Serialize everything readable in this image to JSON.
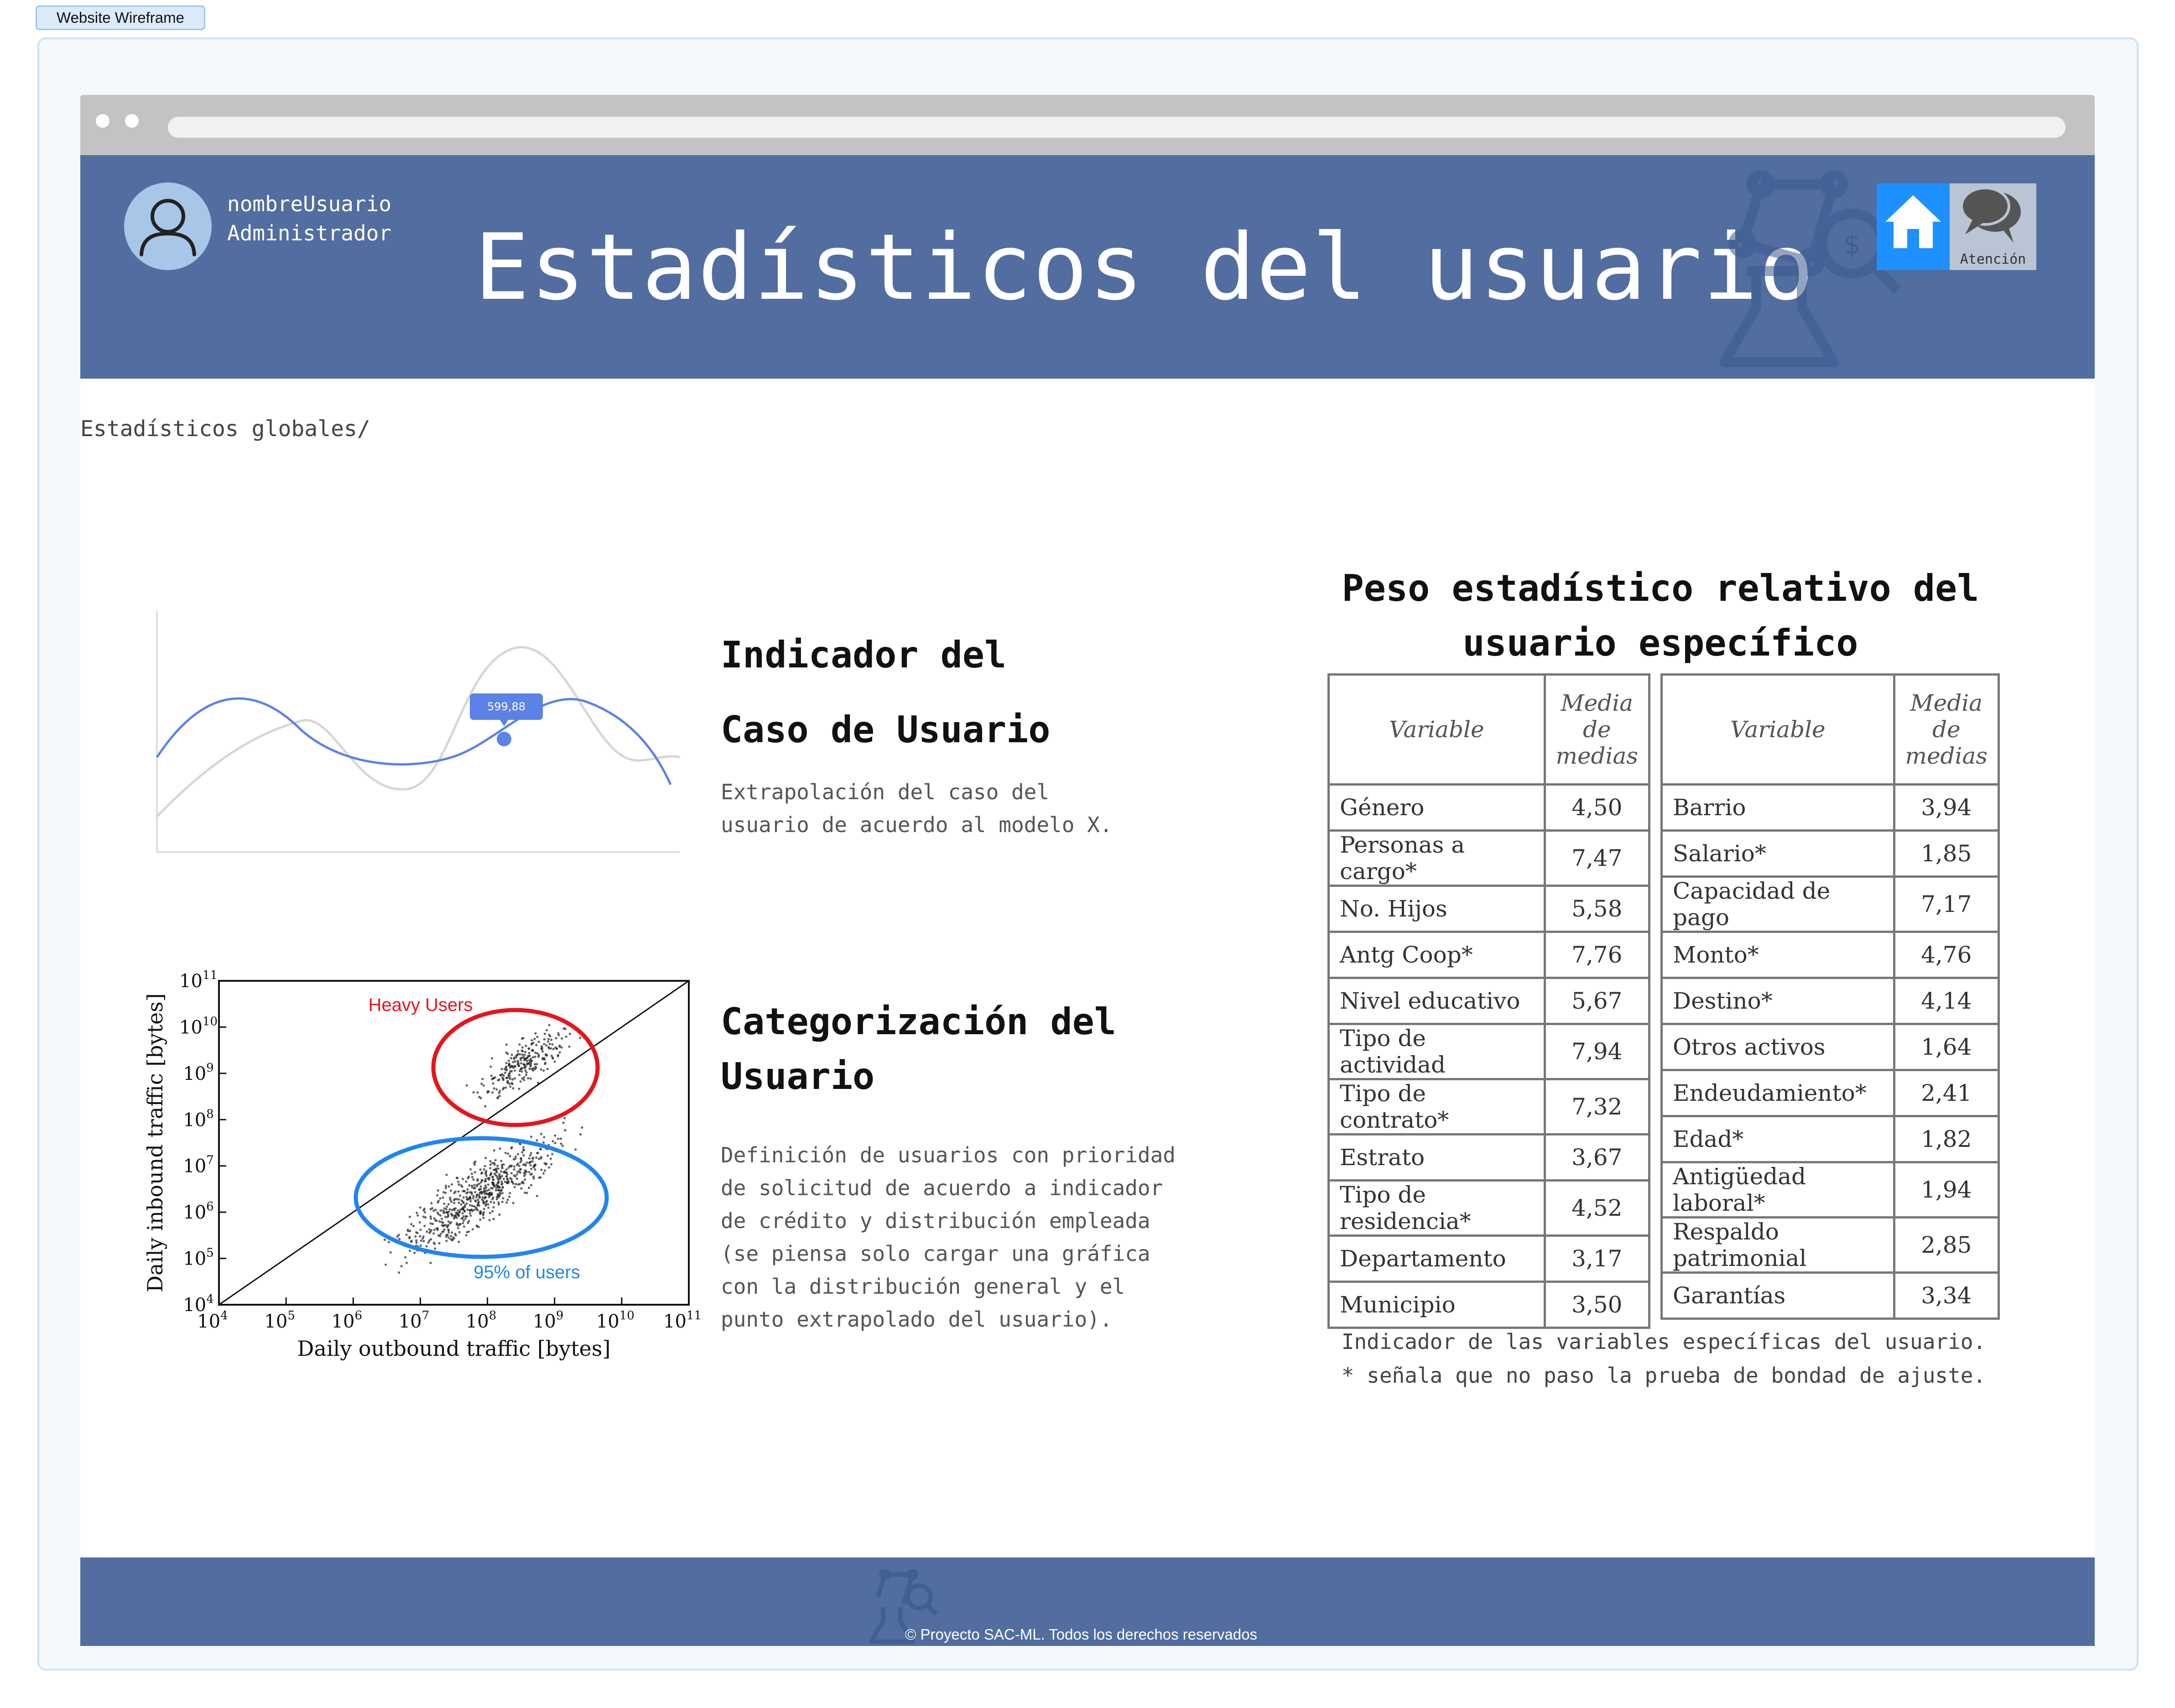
{
  "frame": {
    "label": "Website Wireframe"
  },
  "user": {
    "name": "nombreUsuario",
    "role": "Administrador"
  },
  "header": {
    "title": "Estadísticos del usuario",
    "attention_label": "Atención"
  },
  "breadcrumb": "Estadísticos globales/",
  "indicator": {
    "title_line1": "Indicador del",
    "title_line2": "Caso de Usuario",
    "description": "Extrapolación del caso del\nusuario de acuerdo al modelo X.",
    "tooltip_value": "599,88"
  },
  "categorization": {
    "title_line1": "Categorización del",
    "title_line2": "Usuario",
    "description": "Definición de usuarios con prioridad\nde solicitud de acuerdo a indicador\nde crédito y distribución empleada\n(se piensa solo cargar una gráfica\ncon la distribución general y el\npunto extrapolado del usuario)."
  },
  "scatter": {
    "heavy_label": "Heavy Users",
    "users_label": "95% of users",
    "xlabel": "Daily outbound traffic [bytes]",
    "ylabel": "Daily inbound traffic [bytes]",
    "tick_base": "10",
    "x_exponents": [
      "4",
      "5",
      "6",
      "7",
      "8",
      "9",
      "10",
      "11"
    ],
    "y_exponents": [
      "4",
      "5",
      "6",
      "7",
      "8",
      "9",
      "10",
      "11"
    ]
  },
  "stats": {
    "title_line1": "Peso estadístico relativo del",
    "title_line2": "usuario específico",
    "headers": {
      "variable": "Variable",
      "media_left": "Media de medias",
      "media_right": "Media de medias"
    },
    "left_rows": [
      {
        "variable": "Género",
        "value": "4,50"
      },
      {
        "variable": "Personas a cargo*",
        "value": "7,47"
      },
      {
        "variable": "No. Hijos",
        "value": "5,58"
      },
      {
        "variable": "Antg Coop*",
        "value": "7,76"
      },
      {
        "variable": "Nivel educativo",
        "value": "5,67"
      },
      {
        "variable": "Tipo de actividad",
        "value": "7,94"
      },
      {
        "variable": "Tipo de contrato*",
        "value": "7,32"
      },
      {
        "variable": "Estrato",
        "value": "3,67"
      },
      {
        "variable": "Tipo de residencia*",
        "value": "4,52"
      },
      {
        "variable": "Departamento",
        "value": "3,17"
      },
      {
        "variable": "Municipio",
        "value": "3,50"
      }
    ],
    "right_rows": [
      {
        "variable": "Barrio",
        "value": "3,94"
      },
      {
        "variable": "Salario*",
        "value": "1,85"
      },
      {
        "variable": "Capacidad de pago",
        "value": "7,17"
      },
      {
        "variable": "Monto*",
        "value": "4,76"
      },
      {
        "variable": "Destino*",
        "value": "4,14"
      },
      {
        "variable": "Otros activos",
        "value": "1,64"
      },
      {
        "variable": "Endeudamiento*",
        "value": "2,41"
      },
      {
        "variable": "Edad*",
        "value": "1,82"
      },
      {
        "variable": "Antigüedad laboral*",
        "value": "1,94"
      },
      {
        "variable": "Respaldo patrimonial",
        "value": "2,85"
      },
      {
        "variable": "Garantías",
        "value": "3,34"
      }
    ],
    "caption": "Indicador de las variables específicas del usuario.\n* señala que no paso la prueba de bondad de ajuste."
  },
  "footer": {
    "copyright": "© Proyecto SAC-ML. Todos los derechos reservados"
  },
  "colors": {
    "header_bg": "#526d9f",
    "home_button": "#1e90ff",
    "curve_blue": "#5b82e6",
    "heavy_red": "#e5151c",
    "users_blue": "#1f86f0"
  },
  "icons": [
    "user-avatar-icon",
    "home-icon",
    "chat-icon",
    "logo-icon"
  ]
}
